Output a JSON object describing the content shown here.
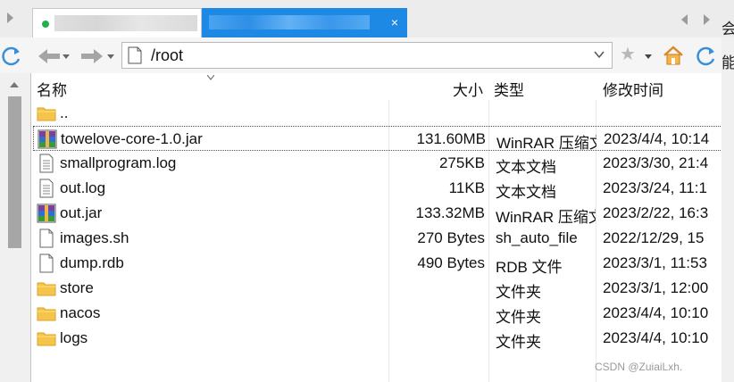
{
  "tabs": [
    {
      "label": "",
      "status_color": "#21b14b",
      "active": false
    },
    {
      "label": "",
      "close": "×",
      "active": true,
      "color": "#1e88e5"
    }
  ],
  "side_text": [
    "会",
    "能"
  ],
  "toolbar": {
    "path": "/root"
  },
  "header": {
    "name": "名称",
    "size": "大小",
    "type": "类型",
    "modified": "修改时间"
  },
  "files": [
    {
      "name": "..",
      "size": "",
      "type": "",
      "modified": "",
      "icon": "folder-icon"
    },
    {
      "name": "towelove-core-1.0.jar",
      "size": "131.60MB",
      "type": "WinRAR 压缩文件",
      "modified": "2023/4/4, 10:14",
      "icon": "winrar-icon",
      "selected": true
    },
    {
      "name": "smallprogram.log",
      "size": "275KB",
      "type": "文本文档",
      "modified": "2023/3/30, 21:4",
      "icon": "text-file-icon"
    },
    {
      "name": "out.log",
      "size": "11KB",
      "type": "文本文档",
      "modified": "2023/3/24, 11:1",
      "icon": "text-file-icon"
    },
    {
      "name": "out.jar",
      "size": "133.32MB",
      "type": "WinRAR 压缩文件",
      "modified": "2023/2/22, 16:3",
      "icon": "winrar-icon"
    },
    {
      "name": "images.sh",
      "size": "270 Bytes",
      "type": "sh_auto_file",
      "modified": "2022/12/29, 15",
      "icon": "blank-file-icon"
    },
    {
      "name": "dump.rdb",
      "size": "490 Bytes",
      "type": "RDB 文件",
      "modified": "2023/3/1, 11:53",
      "icon": "blank-file-icon"
    },
    {
      "name": "store",
      "size": "",
      "type": "文件夹",
      "modified": "2023/3/1, 12:00",
      "icon": "folder-icon"
    },
    {
      "name": "nacos",
      "size": "",
      "type": "文件夹",
      "modified": "2023/4/4, 10:10",
      "icon": "folder-icon"
    },
    {
      "name": "logs",
      "size": "",
      "type": "文件夹",
      "modified": "2023/4/4, 10:10",
      "icon": "folder-icon"
    }
  ],
  "watermark": "CSDN @ZuiaiLxh."
}
